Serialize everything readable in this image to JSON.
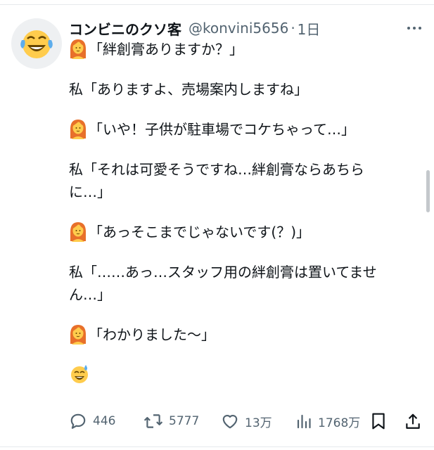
{
  "tweet": {
    "author_name": "コンビニのクソ客",
    "handle": "@konvini5656",
    "separator": "·",
    "time": "1日",
    "lines": {
      "l1": "「絆創膏ありますか？」",
      "l2": "私「ありますよ、売場案内しますね」",
      "l3": "「いや！子供が駐車場でコケちゃって…」",
      "l4a": "私「それは可愛そうですね…絆創膏ならあちら",
      "l4b": "に…」",
      "l5": "「あっそこまでじゃないです(？)」",
      "l6a": "私「……あっ…スタッフ用の絆創膏は置いてませ",
      "l6b": "ん…」",
      "l7": "「わかりました〜」"
    }
  },
  "actions": {
    "replies": "446",
    "retweets": "5777",
    "likes": "13万",
    "views": "1768万"
  },
  "icons": [
    "avatar-laughing-emoji",
    "more-icon",
    "woman-emoji",
    "sweat-smile-emoji",
    "reply-icon",
    "retweet-icon",
    "like-icon",
    "views-icon",
    "bookmark-icon",
    "share-icon"
  ],
  "colors": {
    "text": "#0f1419",
    "muted": "#536471",
    "hair": "#e8702a",
    "skin": "#ffcc4d"
  }
}
